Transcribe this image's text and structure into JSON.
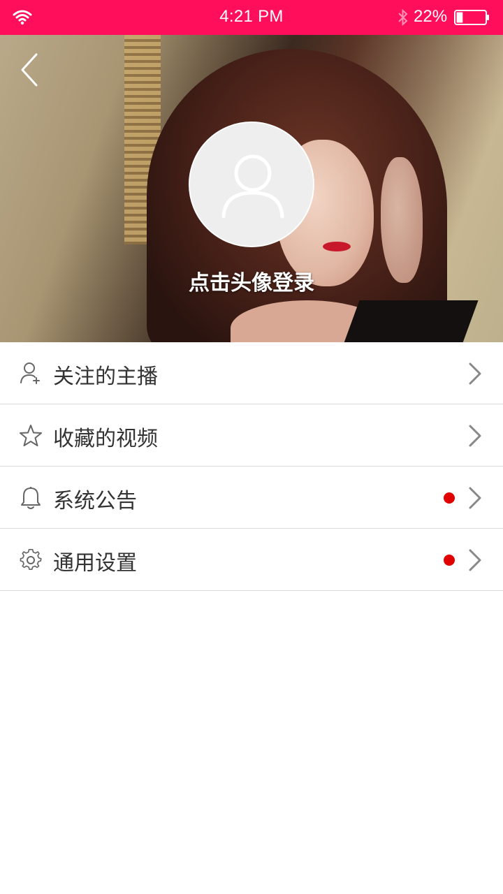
{
  "status_bar": {
    "time": "4:21 PM",
    "battery_percent": "22%",
    "battery_level": 0.22,
    "icons": [
      "wifi-icon",
      "bluetooth-icon",
      "battery-icon"
    ]
  },
  "header": {
    "back_icon": "chevron-left-icon",
    "avatar_icon": "user-icon",
    "login_prompt": "点击头像登录"
  },
  "menu": {
    "items": [
      {
        "label": "关注的主播",
        "icon": "user-plus-icon",
        "badge": false
      },
      {
        "label": "收藏的视频",
        "icon": "star-icon",
        "badge": false
      },
      {
        "label": "系统公告",
        "icon": "bell-icon",
        "badge": true
      },
      {
        "label": "通用设置",
        "icon": "gear-icon",
        "badge": true
      }
    ]
  },
  "colors": {
    "status_bar": "#ff0f5b",
    "badge": "#e00000",
    "text": "#333333",
    "divider": "#dcdcdc"
  }
}
